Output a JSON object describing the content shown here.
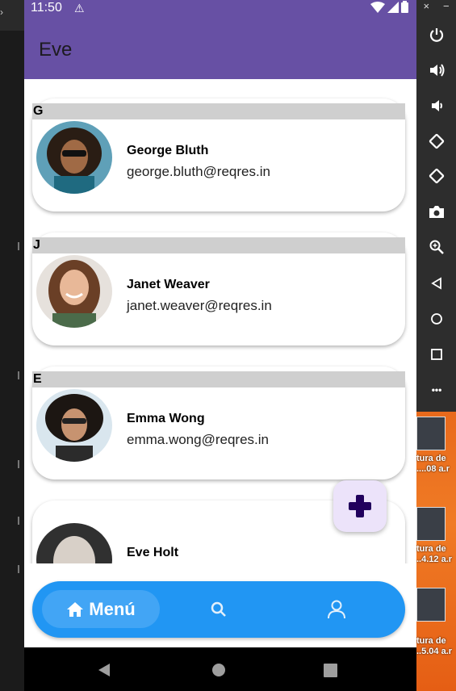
{
  "statusbar": {
    "time": "11:50",
    "warning_glyph": "⚠"
  },
  "appbar": {
    "title": "Eve"
  },
  "contacts": [
    {
      "letter": "G",
      "name": "George Bluth",
      "email": "george.bluth@reqres.in"
    },
    {
      "letter": "J",
      "name": "Janet Weaver",
      "email": "janet.weaver@reqres.in"
    },
    {
      "letter": "E",
      "name": "Emma Wong",
      "email": "emma.wong@reqres.in"
    },
    {
      "letter": "",
      "name": "Eve Holt",
      "email": ""
    }
  ],
  "fab": {
    "icon": "plus-icon"
  },
  "bottom_nav": {
    "items": [
      {
        "label": "Menú",
        "icon": "home-icon",
        "active": true
      },
      {
        "label": "",
        "icon": "search-icon",
        "active": false
      },
      {
        "label": "",
        "icon": "person-icon",
        "active": false
      }
    ]
  },
  "emulator_toolbar": {
    "close_glyph": "×",
    "minimize_glyph": "−",
    "buttons": [
      "power-icon",
      "volume-up-icon",
      "volume-down-icon",
      "rotate-left-icon",
      "rotate-right-icon",
      "camera-icon",
      "zoom-icon",
      "back-icon",
      "home-icon",
      "overview-icon",
      "more-icon"
    ],
    "more_glyph": "•••"
  },
  "desktop_files": [
    {
      "line1": "tura de",
      "line2": "....08 a.r"
    },
    {
      "line1": "tura de",
      "line2": "..4.12 a.r"
    },
    {
      "line1": "tura de",
      "line2": "..5.04 a.r"
    }
  ],
  "colors": {
    "appbar": "#6750a4",
    "nav": "#2196f3",
    "fab": "#ece3fa",
    "fab_icon": "#21005d"
  }
}
